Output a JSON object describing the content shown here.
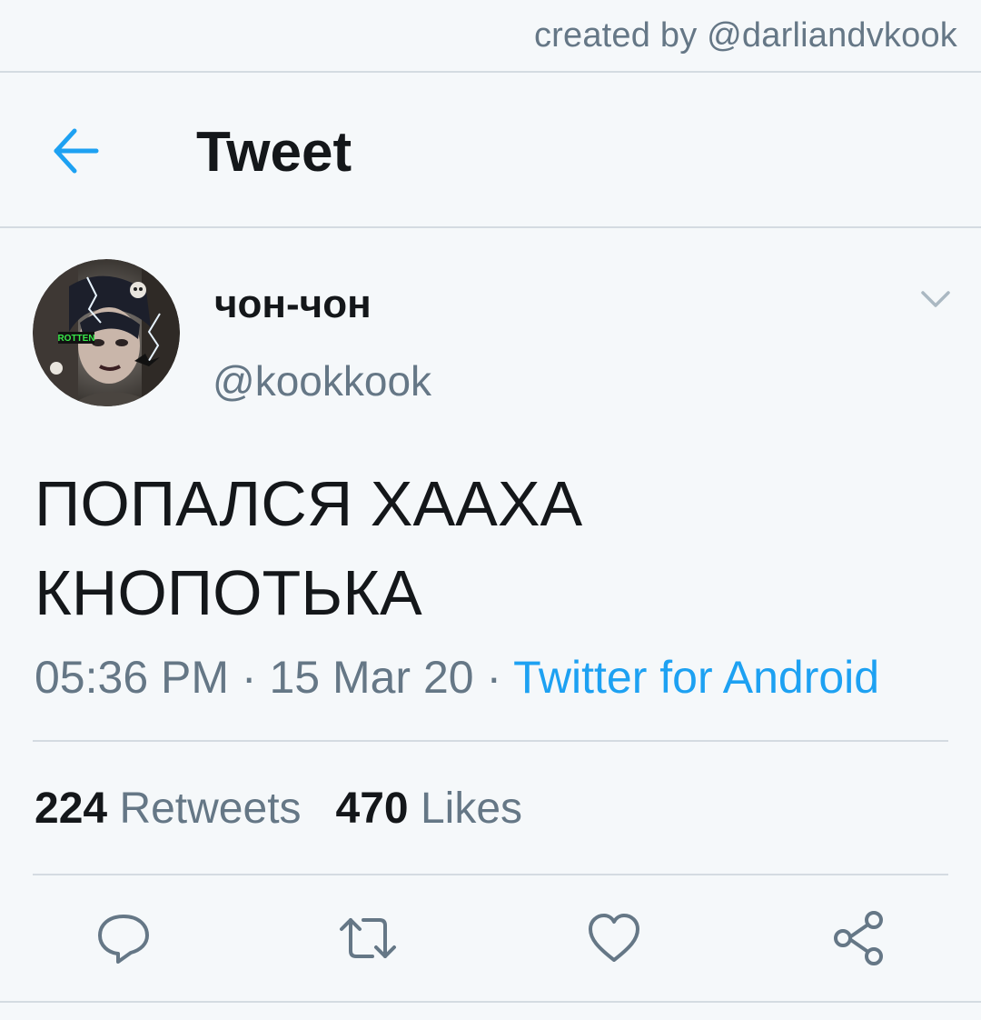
{
  "watermark": "created by @darliandvkook",
  "header": {
    "title": "Tweet",
    "back_icon": "arrow-left-icon"
  },
  "tweet": {
    "author": {
      "name": "чон-чон",
      "handle": "@kookkook",
      "avatar_badge": "ROTTEN"
    },
    "text_lines": [
      "ПОПАЛСЯ ХААХА",
      "КНОПОТЬКА"
    ],
    "time": "05:36 PM",
    "date": "15 Mar 20",
    "separator": " · ",
    "source": "Twitter for Android",
    "retweets": {
      "count": "224",
      "label": "Retweets"
    },
    "likes": {
      "count": "470",
      "label": "Likes"
    }
  },
  "actions": [
    {
      "name": "reply",
      "icon": "reply-icon"
    },
    {
      "name": "retweet",
      "icon": "retweet-icon"
    },
    {
      "name": "like",
      "icon": "heart-icon"
    },
    {
      "name": "share",
      "icon": "share-icon"
    }
  ],
  "colors": {
    "accent": "#1da1f2",
    "secondary_text": "#657786",
    "primary_text": "#14171a",
    "divider": "#d4dbe1",
    "background": "#f5f8fa"
  }
}
